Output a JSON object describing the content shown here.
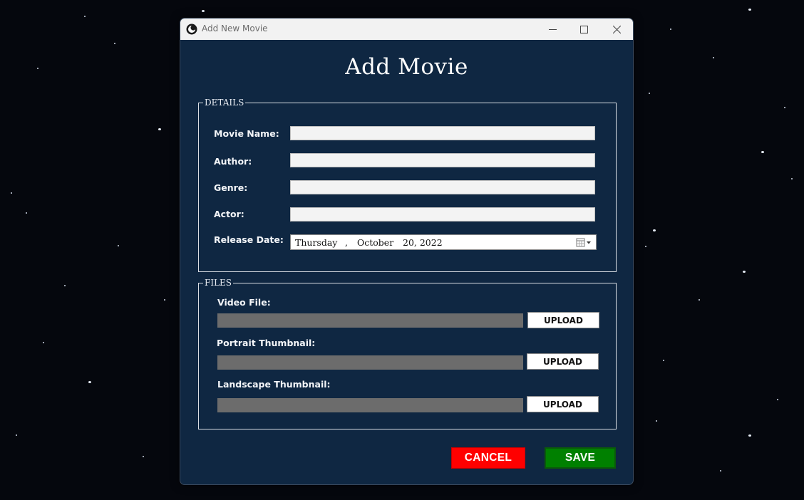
{
  "window": {
    "title": "Add New Movie",
    "heading": "Add Movie"
  },
  "details": {
    "legend": "DETAILS",
    "fields": [
      {
        "label": "Movie Name:",
        "value": ""
      },
      {
        "label": "Author:",
        "value": ""
      },
      {
        "label": "Genre:",
        "value": ""
      },
      {
        "label": "Actor:",
        "value": ""
      }
    ],
    "release_date": {
      "label": "Release Date:",
      "weekday": "Thursday",
      "sep": ",",
      "month": "October",
      "day_year": "20, 2022"
    }
  },
  "files": {
    "legend": "FILES",
    "items": [
      {
        "label": "Video File:",
        "button": "UPLOAD"
      },
      {
        "label": "Portrait Thumbnail:",
        "button": "UPLOAD"
      },
      {
        "label": "Landscape Thumbnail:",
        "button": "UPLOAD"
      }
    ]
  },
  "actions": {
    "cancel": "CANCEL",
    "save": "SAVE"
  },
  "colors": {
    "window_bg": "#0f2742",
    "cancel": "#ff0000",
    "save": "#008000",
    "desktop_bg": "#05070d"
  }
}
